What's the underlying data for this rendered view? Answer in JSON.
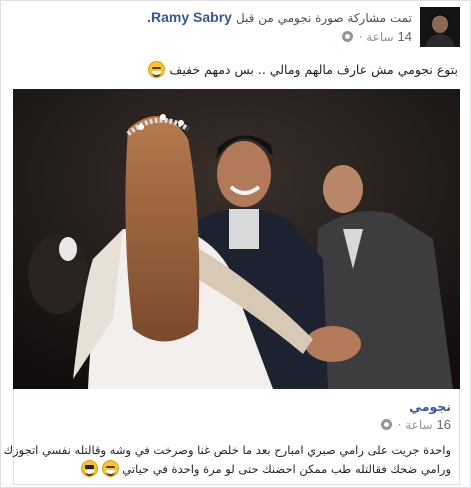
{
  "post": {
    "author": "Ramy Sabry",
    "action_text": "تمت مشاركة صورة نجومي من قبل",
    "time_number": "14",
    "time_unit": "ساعة ·",
    "caption": "بتوع نجومي مش عارف مالهم ومالي .. بس دمهم خفيف",
    "caption_emoji": "grinning-squinting-face-emoji"
  },
  "shared": {
    "page_name": "نجومي",
    "time_number": "16",
    "time_unit": "ساعة ·",
    "text_line1": "واحدة جريت على رامي صبري امبارح بعد ما خلص غنا وصرخت في وشه وقالتله نفسي اتجوزك",
    "text_line2": "ورامي ضحك فقالتله طب ممكن احضنك حتى لو مرة واحدة في حياتي",
    "emojis": [
      "grinning-squinting-face-emoji",
      "smiling-face-with-sunglasses-emoji"
    ]
  },
  "colors": {
    "link_blue": "#365899",
    "meta_gray": "#90949c",
    "border": "#dddfe2"
  }
}
